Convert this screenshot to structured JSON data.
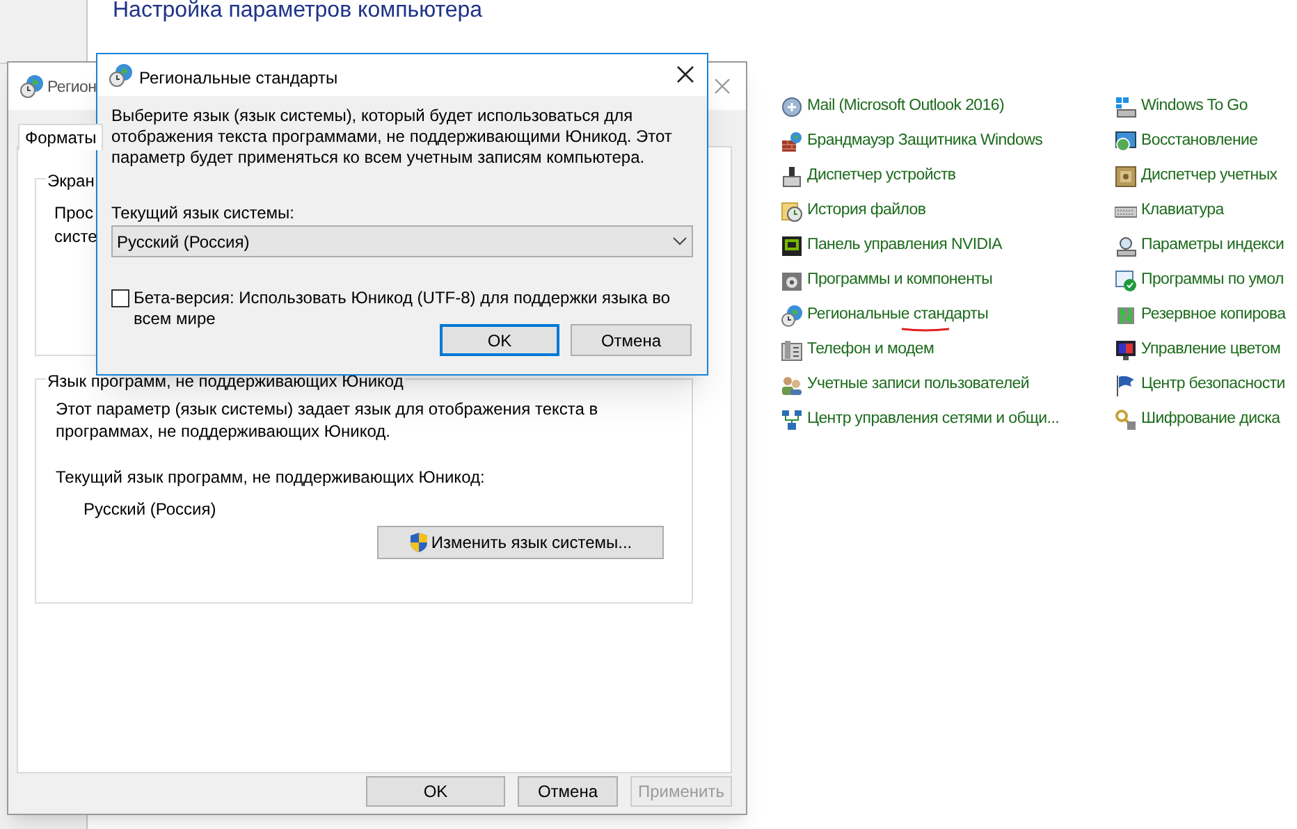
{
  "control_panel": {
    "title": "Настройка параметров компьютера",
    "column_1": [
      {
        "label": "Mail (Microsoft Outlook 2016)",
        "underlined": false
      },
      {
        "label": "Брандмауэр Защитника Windows",
        "underlined": false
      },
      {
        "label": "Диспетчер устройств",
        "underlined": false
      },
      {
        "label": "История файлов",
        "underlined": false
      },
      {
        "label": "Панель управления NVIDIA",
        "underlined": false
      },
      {
        "label": "Программы и компоненты",
        "underlined": false
      },
      {
        "label": "Региональные стандарты",
        "underlined": true
      },
      {
        "label": "Телефон и модем",
        "underlined": false
      },
      {
        "label": "Учетные записи пользователей",
        "underlined": false
      },
      {
        "label": "Центр управления сетями и общи...",
        "underlined": false
      }
    ],
    "column_2": [
      {
        "label": "Windows To Go"
      },
      {
        "label": "Восстановление"
      },
      {
        "label": "Диспетчер учетных"
      },
      {
        "label": "Клавиатура"
      },
      {
        "label": "Параметры индекси"
      },
      {
        "label": "Программы по умол"
      },
      {
        "label": "Резервное копирова"
      },
      {
        "label": "Управление цветом"
      },
      {
        "label": "Центр безопасности"
      },
      {
        "label": "Шифрование диска"
      }
    ]
  },
  "region_window": {
    "title": "Регион",
    "tabs": [
      {
        "label": "Форматы",
        "selected": true
      }
    ],
    "screen_group": {
      "title": "Экран",
      "lines": [
        "Прос",
        "систе"
      ]
    },
    "unicode_group": {
      "title": "Язык программ, не поддерживающих Юникод",
      "description": "Этот параметр (язык системы) задает язык для отображения текста в программах, не поддерживающих Юникод.",
      "current_label": "Текущий язык программ, не поддерживающих Юникод:",
      "current_value": "Русский (Россия)",
      "change_button": "Изменить язык системы..."
    },
    "buttons": [
      {
        "label": "OK",
        "disabled": false
      },
      {
        "label": "Отмена",
        "disabled": false
      },
      {
        "label": "Применить",
        "disabled": true
      }
    ]
  },
  "dialog": {
    "title": "Региональные стандарты",
    "description": "Выберите язык (язык системы), который будет использоваться для отображения текста программами, не поддерживающими Юникод. Этот параметр будет применяться ко всем учетным записям компьютера.",
    "label": "Текущий язык системы:",
    "dropdown": {
      "value": "Русский (Россия)"
    },
    "checkbox": {
      "label": "Бета-версия: Использовать Юникод (UTF-8) для поддержки языка во всем мире",
      "checked": false
    },
    "buttons": [
      {
        "label": "OK",
        "default": true
      },
      {
        "label": "Отмена",
        "default": false
      }
    ]
  }
}
